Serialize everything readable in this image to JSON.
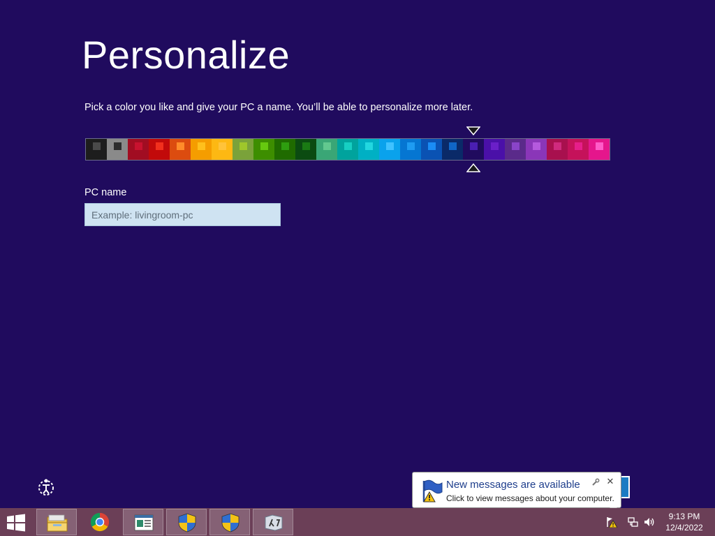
{
  "page": {
    "title": "Personalize",
    "subtitle": "Pick a color you like and give your PC a name. You’ll be able to personalize more later.",
    "pc_name_label": "PC name",
    "pc_name_placeholder": "Example: livingroom-pc",
    "pc_name_value": ""
  },
  "color_picker": {
    "selected_index": 18,
    "swatches": [
      {
        "bg": "#1d1d1d",
        "dot": "#4a4a4a"
      },
      {
        "bg": "#8a8a8a",
        "dot": "#2d2d2d"
      },
      {
        "bg": "#a10d22",
        "dot": "#c8122f"
      },
      {
        "bg": "#c20a0a",
        "dot": "#f2301d"
      },
      {
        "bg": "#dc4c0f",
        "dot": "#ff8c2a"
      },
      {
        "bg": "#f59d00",
        "dot": "#ffc01c"
      },
      {
        "bg": "#fdb813",
        "dot": "#ffc33a"
      },
      {
        "bg": "#7aa23a",
        "dot": "#9ec62b"
      },
      {
        "bg": "#3d8e00",
        "dot": "#66c90f"
      },
      {
        "bg": "#1f6b00",
        "dot": "#2e9e0f"
      },
      {
        "bg": "#0b4b11",
        "dot": "#1a7a14"
      },
      {
        "bg": "#3aa676",
        "dot": "#62c88f"
      },
      {
        "bg": "#00a39d",
        "dot": "#16cfc2"
      },
      {
        "bg": "#00b0c4",
        "dot": "#22d7e0"
      },
      {
        "bg": "#0aa2ec",
        "dot": "#40c2ff"
      },
      {
        "bg": "#0576d2",
        "dot": "#1e9cf2"
      },
      {
        "bg": "#0a52b3",
        "dot": "#1a8cf5"
      },
      {
        "bg": "#0a2a68",
        "dot": "#1066c6"
      },
      {
        "bg": "#200b5e",
        "dot": "#4a1fb3"
      },
      {
        "bg": "#4a10a8",
        "dot": "#6a1fc8"
      },
      {
        "bg": "#5a2a8a",
        "dot": "#8a44c8"
      },
      {
        "bg": "#8a36b8",
        "dot": "#b55ade"
      },
      {
        "bg": "#a8104e",
        "dot": "#d02a7e"
      },
      {
        "bg": "#c5125a",
        "dot": "#e61e8a"
      },
      {
        "bg": "#e5168c",
        "dot": "#ff5cc8"
      }
    ]
  },
  "notification": {
    "title": "New messages are available",
    "text": "Click to view messages about your computer."
  },
  "taskbar": {
    "items": [
      {
        "name": "file-explorer-taskbar-button",
        "icon": "folder-icon",
        "pinned": true
      },
      {
        "name": "chrome-taskbar-button",
        "icon": "chrome-icon",
        "pinned": false
      },
      {
        "name": "window-taskbar-button",
        "icon": "window-icon",
        "pinned": true
      },
      {
        "name": "uac-taskbar-button-1",
        "icon": "shield-icon",
        "pinned": true
      },
      {
        "name": "uac-taskbar-button-2",
        "icon": "shield-icon",
        "pinned": true
      },
      {
        "name": "app-taskbar-button",
        "icon": "lambda-icon",
        "pinned": true
      }
    ],
    "clock_time": "9:13 PM",
    "clock_date": "12/4/2022"
  },
  "icons": {
    "ease_of_access": "ease-of-access-icon",
    "start": "windows-logo-icon",
    "tray_warning": "action-center-warning-icon",
    "tray_network": "network-icon",
    "tray_volume": "volume-icon"
  }
}
